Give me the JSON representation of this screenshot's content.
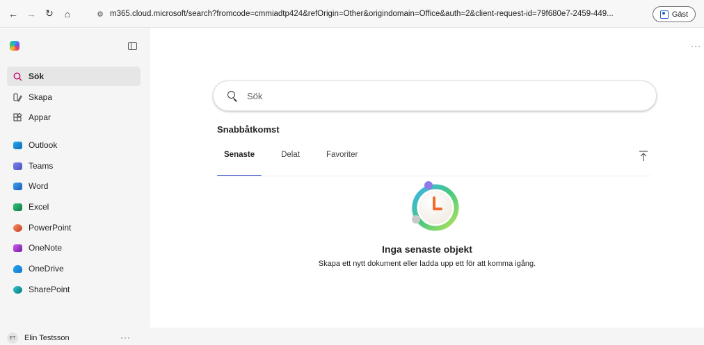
{
  "browser": {
    "url": "m365.cloud.microsoft/search?fromcode=cmmiadtp424&refOrigin=Other&origindomain=Office&auth=2&client-request-id=79f680e7-2459-449...",
    "guest_label": "Gäst",
    "icons": [
      "back-icon",
      "forward-icon",
      "reload-icon",
      "home-icon",
      "site-settings-icon"
    ]
  },
  "sidebar": {
    "items": [
      {
        "label": "Sök",
        "icon": "search-icon",
        "active": true
      },
      {
        "label": "Skapa",
        "icon": "create-icon"
      },
      {
        "label": "Appar",
        "icon": "apps-icon"
      }
    ],
    "apps": [
      {
        "label": "Outlook",
        "color": "#0f6cbd"
      },
      {
        "label": "Teams",
        "color": "#5b5fc7"
      },
      {
        "label": "Word",
        "color": "#185abd"
      },
      {
        "label": "Excel",
        "color": "#107c41"
      },
      {
        "label": "PowerPoint",
        "color": "#c43e1c"
      },
      {
        "label": "OneNote",
        "color": "#7719aa"
      },
      {
        "label": "OneDrive",
        "color": "#0f78d4"
      },
      {
        "label": "SharePoint",
        "color": "#03787c"
      }
    ],
    "user": {
      "initials": "ET",
      "name": "Elin Testsson"
    }
  },
  "main": {
    "search_placeholder": "Sök",
    "quick_access_title": "Snabbåtkomst",
    "tabs": [
      {
        "label": "Senaste",
        "active": true
      },
      {
        "label": "Delat"
      },
      {
        "label": "Favoriter"
      }
    ],
    "empty_title": "Inga senaste objekt",
    "empty_subtitle": "Skapa ett nytt dokument eller ladda upp ett för att komma igång."
  },
  "colors": {
    "accent": "#3d4fcf",
    "search_accent": "#c50f6a"
  }
}
